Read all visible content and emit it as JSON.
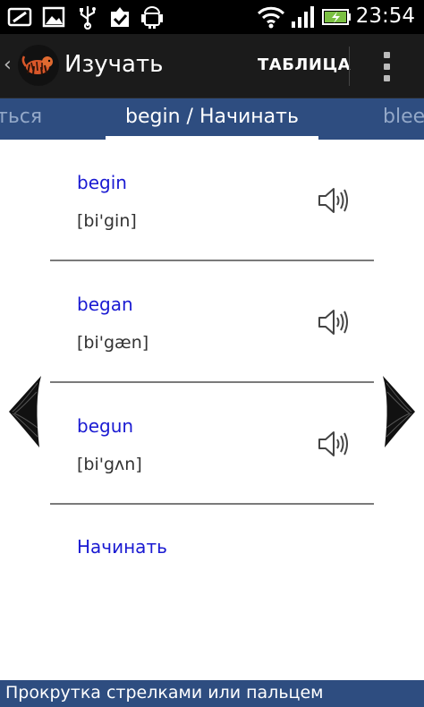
{
  "status_bar": {
    "time": "23:54",
    "icons": [
      "screen-sync-icon",
      "image-icon",
      "usb-icon",
      "checkbox-icon",
      "android-icon",
      "wifi-icon",
      "signal-icon",
      "battery-charging-icon"
    ]
  },
  "action_bar": {
    "title": "Изучать",
    "table_button": "ТАБЛИЦА"
  },
  "tabs": {
    "prev": "ться",
    "current": "begin / Начинать",
    "next": "blee"
  },
  "forms": [
    {
      "word": "begin",
      "transcription": "[bi'gin]"
    },
    {
      "word": "began",
      "transcription": "[bi'gæn]"
    },
    {
      "word": "begun",
      "transcription": "[bi'gʌn]"
    }
  ],
  "translation": "Начинать",
  "footer": {
    "hint": "Прокрутка стрелками или пальцем"
  },
  "colors": {
    "accent_blue": "#2e4d80",
    "word_blue": "#1a1ad2",
    "action_bar": "#1b1b1b"
  }
}
